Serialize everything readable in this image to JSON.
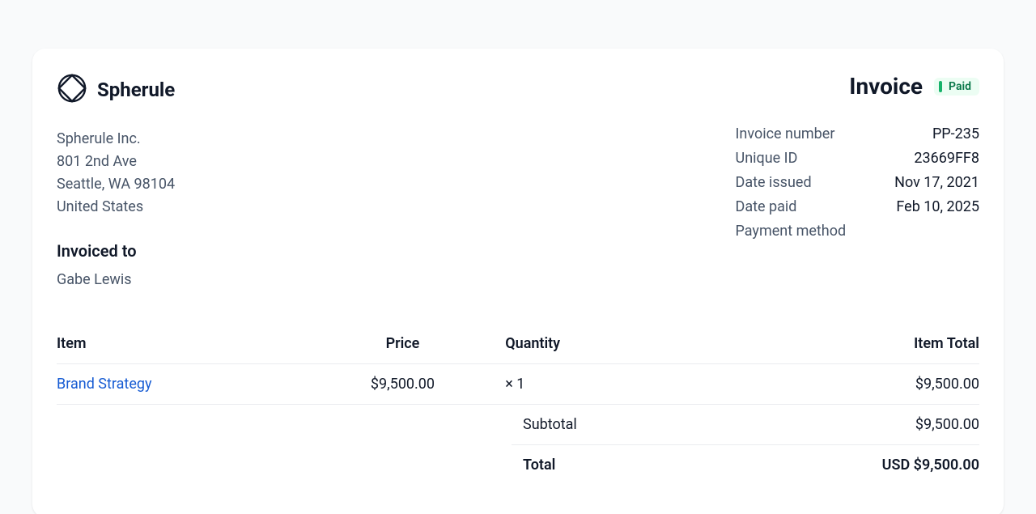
{
  "brand": {
    "name": "Spherule"
  },
  "sender": {
    "name": "Spherule Inc.",
    "street": "801 2nd Ave",
    "city_line": "Seattle, WA 98104",
    "country": "United States"
  },
  "invoice": {
    "title": "Invoice",
    "status": "Paid",
    "meta_labels": {
      "number": "Invoice number",
      "unique_id": "Unique ID",
      "date_issued": "Date issued",
      "date_paid": "Date paid",
      "payment_method": "Payment method"
    },
    "meta_values": {
      "number": "PP-235",
      "unique_id": "23669FF8",
      "date_issued": "Nov 17, 2021",
      "date_paid": "Feb 10, 2025",
      "payment_method": ""
    }
  },
  "billed_to": {
    "label": "Invoiced to",
    "name": "Gabe Lewis"
  },
  "table": {
    "headers": {
      "item": "Item",
      "price": "Price",
      "quantity": "Quantity",
      "total": "Item Total"
    },
    "rows": [
      {
        "item": "Brand Strategy",
        "price": "$9,500.00",
        "quantity": "× 1",
        "total": "$9,500.00"
      }
    ]
  },
  "totals": {
    "subtotal_label": "Subtotal",
    "subtotal_value": "$9,500.00",
    "total_label": "Total",
    "total_value": "USD $9,500.00"
  }
}
